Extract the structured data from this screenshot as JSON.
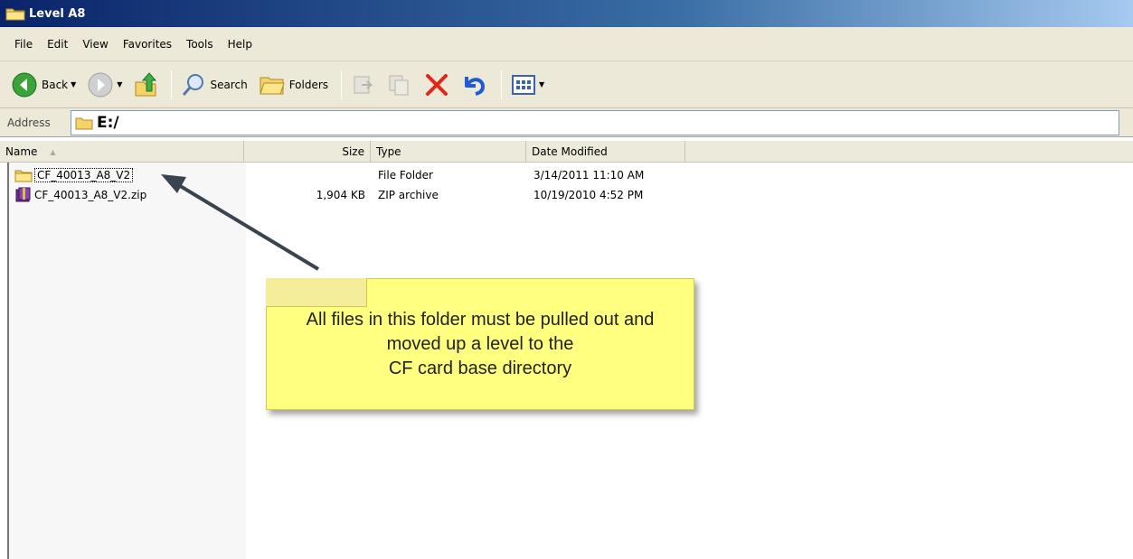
{
  "window": {
    "title": "Level A8",
    "icon": "folder-icon"
  },
  "menu": {
    "items": [
      "File",
      "Edit",
      "View",
      "Favorites",
      "Tools",
      "Help"
    ]
  },
  "toolbar": {
    "back_label": "Back",
    "search_label": "Search",
    "folders_label": "Folders"
  },
  "address": {
    "label": "Address",
    "value": "E:/"
  },
  "columns": {
    "name": "Name",
    "size": "Size",
    "type": "Type",
    "date": "Date Modified"
  },
  "files": [
    {
      "name": "CF_40013_A8_V2",
      "size": "",
      "type": "File Folder",
      "date": "3/14/2011 11:10 AM",
      "icon": "folder-icon"
    },
    {
      "name": "CF_40013_A8_V2.zip",
      "size": "1,904 KB",
      "type": "ZIP archive",
      "date": "10/19/2010 4:52 PM",
      "icon": "zip-archive-icon"
    }
  ],
  "annotation": {
    "line1": "All files in this folder must be pulled out and",
    "line2": "moved up a level to the",
    "line3": "CF card base directory"
  },
  "colors": {
    "titlebar": "#0a246a",
    "chrome": "#ece9d8",
    "callout": "#ffff80",
    "delete_x": "#e0261b",
    "undo": "#1f5bd8"
  }
}
